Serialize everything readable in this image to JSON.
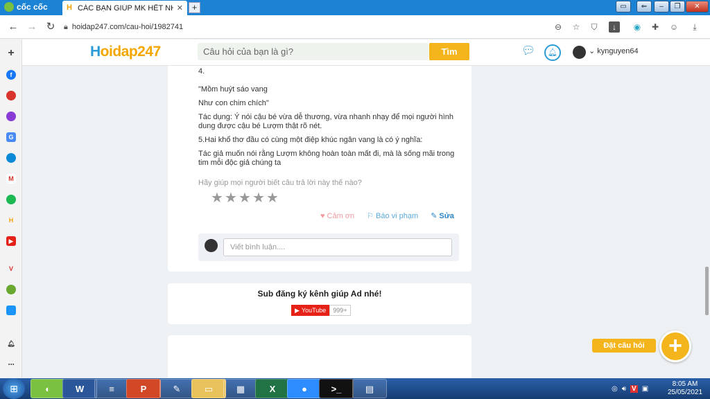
{
  "browser": {
    "brand": "cốc cốc",
    "tab_title": "CÁC BẠN GIÚP MK HẾT NHA",
    "new_tab": "+",
    "url": "hoidap247.com/cau-hoi/1982741"
  },
  "site": {
    "logo_h": "H",
    "logo_rest": "oidap247",
    "search_placeholder": "Câu hỏi của bạn là gì?",
    "search_button": "Tìm",
    "username": "kynguyen64"
  },
  "answer": {
    "lines": [
      "4.",
      "\"Mồm huýt sáo vang",
      "Như con chim chích\"",
      "Tác dụng: Ý nói cậu bé vừa dễ thương, vừa nhanh nhạy để mọi người hình dung được cậu bé Lượm thật rõ nét.",
      "5.Hai khổ thơ đầu có cùng một điệp khúc ngân vang là có ý nghĩa:",
      "Tác giả muốn nói rằng Lượm không hoàn toàn mất đi, mà là sống mãi trong tim mỗi độc giả chúng ta"
    ],
    "help_text": "Hãy giúp mọi người biết câu trả lời này thế nào?",
    "thanks": "Cảm ơn",
    "report": "Báo vi phạm",
    "edit": "Sửa",
    "comment_placeholder": "Viết bình luận...."
  },
  "promo": {
    "title": "Sub đăng ký kênh giúp Ad nhé!",
    "youtube": "YouTube",
    "count": "999+"
  },
  "fab": {
    "ask": "Đặt câu hỏi"
  },
  "taskbar": {
    "time": "8:05 AM",
    "date": "25/05/2021"
  }
}
